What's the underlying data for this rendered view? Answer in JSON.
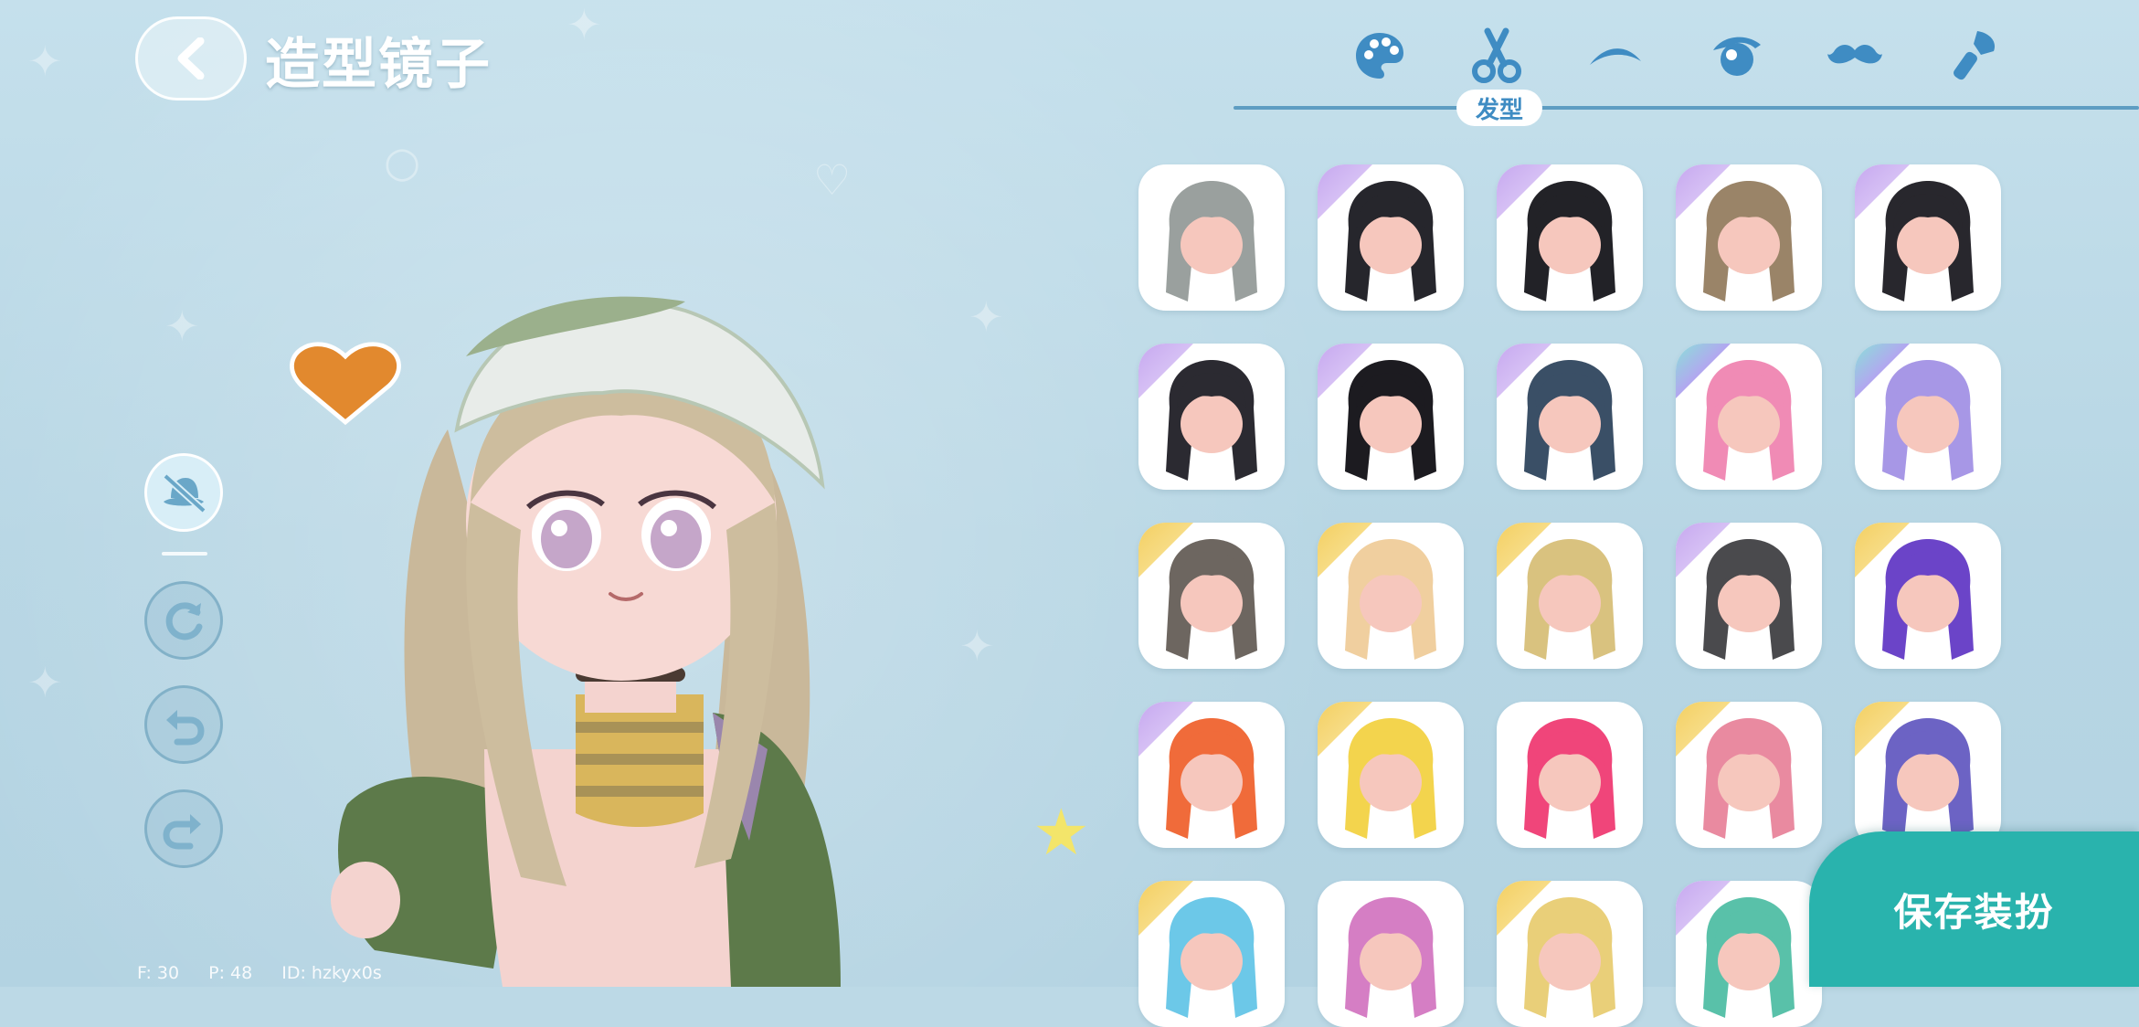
{
  "header": {
    "title": "造型镜子",
    "back_icon": "chevron-left-icon"
  },
  "tabs": [
    {
      "icon": "palette-icon",
      "label": "",
      "active": false
    },
    {
      "icon": "scissors-icon",
      "label": "发型",
      "active": true
    },
    {
      "icon": "eyebrow-icon",
      "label": "",
      "active": false
    },
    {
      "icon": "eye-icon",
      "label": "",
      "active": false
    },
    {
      "icon": "mustache-icon",
      "label": "",
      "active": false
    },
    {
      "icon": "makeup-brush-icon",
      "label": "",
      "active": false
    }
  ],
  "left_controls": [
    {
      "icon": "hide-hat-icon"
    },
    {
      "icon": "reset-icon"
    },
    {
      "icon": "undo-icon"
    },
    {
      "icon": "redo-icon"
    }
  ],
  "stats": {
    "fps": "F: 30",
    "ping": "P: 48",
    "id": "ID: hzkyx0s"
  },
  "save_button": {
    "label": "保存装扮"
  },
  "colors": {
    "accent": "#3f8cc3",
    "save": "#29b3ad",
    "background": "#bcd9e6"
  },
  "hairstyles": [
    {
      "name": "silver-dreadlocks",
      "tier": "none",
      "color": "#9aa09e"
    },
    {
      "name": "black-bun-bangs",
      "tier": "purple",
      "color": "#26262c"
    },
    {
      "name": "black-bun-bangs-2",
      "tier": "purple",
      "color": "#222227"
    },
    {
      "name": "brown-twin-braids",
      "tier": "purple",
      "color": "#9a8468"
    },
    {
      "name": "black-long-bangs",
      "tier": "purple",
      "color": "#28272d"
    },
    {
      "name": "black-grey-long",
      "tier": "purple",
      "color": "#2b2a31"
    },
    {
      "name": "black-long-straight",
      "tier": "purple",
      "color": "#1c1b20"
    },
    {
      "name": "dark-blue-spiky",
      "tier": "purple",
      "color": "#3a4f66"
    },
    {
      "name": "pink-bun-braids",
      "tier": "rainbow",
      "color": "#f08bb5"
    },
    {
      "name": "lilac-bun-braids",
      "tier": "rainbow",
      "color": "#a797e6"
    },
    {
      "name": "grey-braid-bow",
      "tier": "gold",
      "color": "#6d6660"
    },
    {
      "name": "blonde-long-wavy",
      "tier": "gold",
      "color": "#f0cf9f"
    },
    {
      "name": "blonde-long-ribbon",
      "tier": "gold",
      "color": "#d9c27f"
    },
    {
      "name": "black-messy-short",
      "tier": "purple",
      "color": "#4a4a4d"
    },
    {
      "name": "purple-galaxy-long",
      "tier": "gold",
      "color": "#6b44c8"
    },
    {
      "name": "rainbow-ponytail",
      "tier": "purple",
      "color": "#f06b3a"
    },
    {
      "name": "yellow-spiky-horns",
      "tier": "gold",
      "color": "#f3d44d"
    },
    {
      "name": "pink-curly-long",
      "tier": "none",
      "color": "#f0457a"
    },
    {
      "name": "rose-wavy-long",
      "tier": "gold",
      "color": "#e98aa0"
    },
    {
      "name": "violet-side-ponytail",
      "tier": "gold",
      "color": "#6c63c4"
    },
    {
      "name": "sky-blue-long",
      "tier": "gold",
      "color": "#6cc8e8"
    },
    {
      "name": "orchid-curls",
      "tier": "none",
      "color": "#d57ec4"
    },
    {
      "name": "golden-long",
      "tier": "gold",
      "color": "#e9cf79"
    },
    {
      "name": "teal-gradient",
      "tier": "purple",
      "color": "#59c1a9"
    }
  ]
}
